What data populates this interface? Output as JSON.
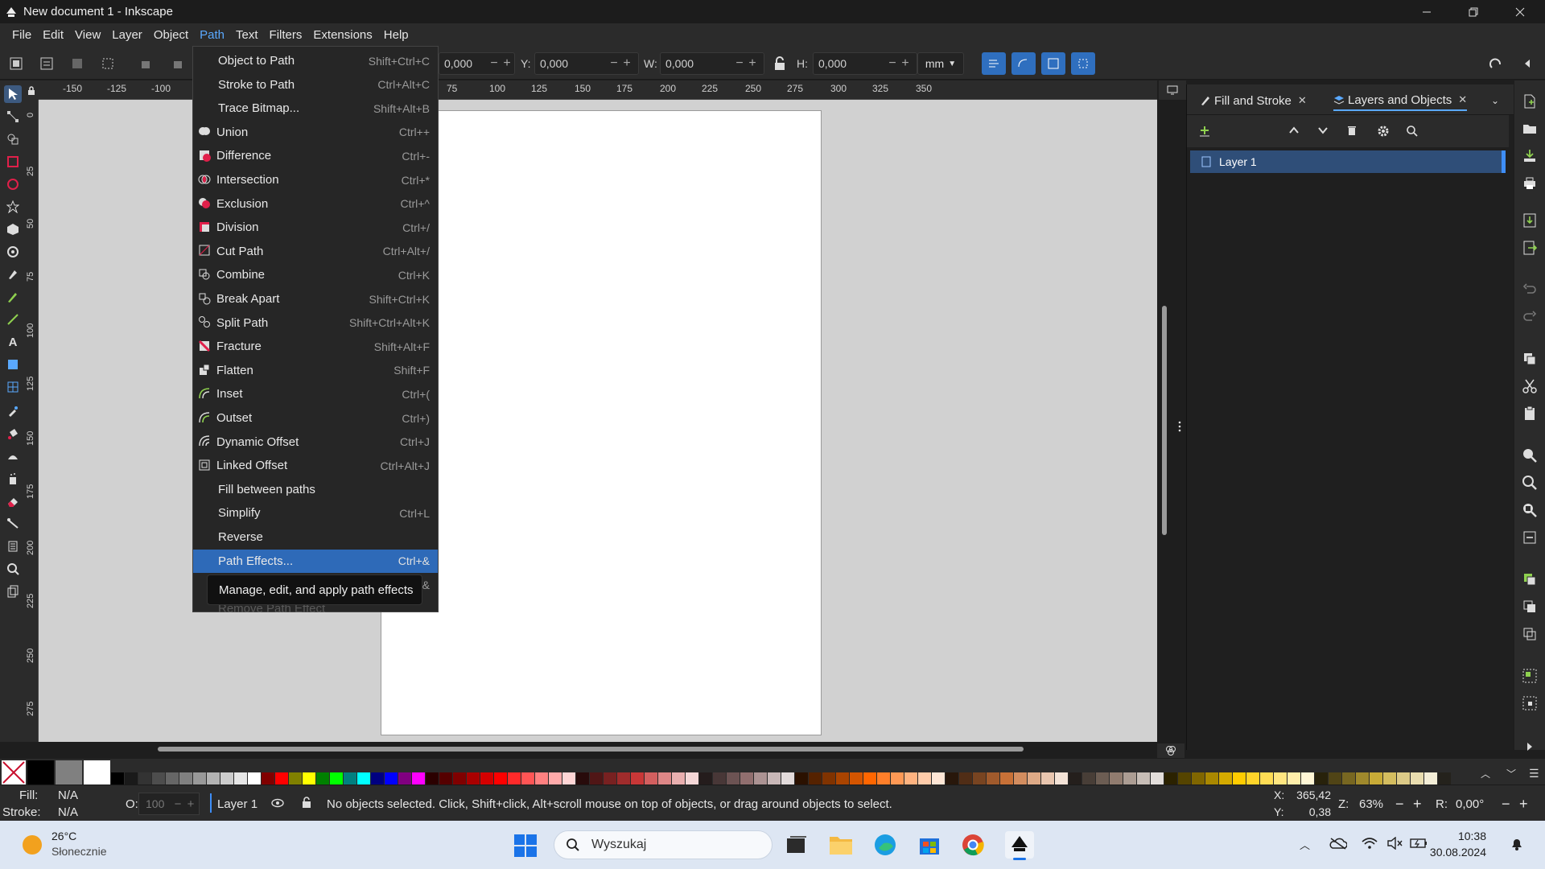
{
  "window": {
    "title": "New document 1 - Inkscape"
  },
  "menubar": [
    "File",
    "Edit",
    "View",
    "Layer",
    "Object",
    "Path",
    "Text",
    "Filters",
    "Extensions",
    "Help"
  ],
  "toolbar": {
    "x_value": "0,000",
    "y_label": "Y:",
    "y_value": "0,000",
    "w_label": "W:",
    "w_value": "0,000",
    "h_label": "H:",
    "h_value": "0,000",
    "unit": "mm"
  },
  "ruler_top": [
    "-150",
    "-125",
    "-100",
    "75",
    "100",
    "125",
    "150",
    "175",
    "200",
    "225",
    "250",
    "275",
    "300",
    "325",
    "350"
  ],
  "ruler_left": [
    "0",
    "25",
    "50",
    "75",
    "100",
    "125",
    "150",
    "175",
    "200",
    "225",
    "250",
    "275"
  ],
  "path_menu": {
    "items": [
      {
        "label": "Object to Path",
        "shortcut": "Shift+Ctrl+C",
        "icon": "none"
      },
      {
        "label": "Stroke to Path",
        "shortcut": "Ctrl+Alt+C",
        "icon": "none"
      },
      {
        "label": "Trace Bitmap...",
        "shortcut": "Shift+Alt+B",
        "icon": "none"
      },
      {
        "label": "Union",
        "shortcut": "Ctrl++",
        "icon": "union-icon"
      },
      {
        "label": "Difference",
        "shortcut": "Ctrl+-",
        "icon": "difference-icon"
      },
      {
        "label": "Intersection",
        "shortcut": "Ctrl+*",
        "icon": "intersection-icon"
      },
      {
        "label": "Exclusion",
        "shortcut": "Ctrl+^",
        "icon": "exclusion-icon"
      },
      {
        "label": "Division",
        "shortcut": "Ctrl+/",
        "icon": "division-icon"
      },
      {
        "label": "Cut Path",
        "shortcut": "Ctrl+Alt+/",
        "icon": "cut-path-icon"
      },
      {
        "label": "Combine",
        "shortcut": "Ctrl+K",
        "icon": "combine-icon"
      },
      {
        "label": "Break Apart",
        "shortcut": "Shift+Ctrl+K",
        "icon": "break-apart-icon"
      },
      {
        "label": "Split Path",
        "shortcut": "Shift+Ctrl+Alt+K",
        "icon": "split-path-icon"
      },
      {
        "label": "Fracture",
        "shortcut": "Shift+Alt+F",
        "icon": "fracture-icon"
      },
      {
        "label": "Flatten",
        "shortcut": "Shift+F",
        "icon": "flatten-icon"
      },
      {
        "label": "Inset",
        "shortcut": "Ctrl+(",
        "icon": "inset-icon"
      },
      {
        "label": "Outset",
        "shortcut": "Ctrl+)",
        "icon": "outset-icon"
      },
      {
        "label": "Dynamic Offset",
        "shortcut": "Ctrl+J",
        "icon": "dynamic-offset-icon"
      },
      {
        "label": "Linked Offset",
        "shortcut": "Ctrl+Alt+J",
        "icon": "linked-offset-icon"
      },
      {
        "label": "Fill between paths",
        "shortcut": "",
        "icon": "none"
      },
      {
        "label": "Simplify",
        "shortcut": "Ctrl+L",
        "icon": "none"
      },
      {
        "label": "Reverse",
        "shortcut": "",
        "icon": "none"
      },
      {
        "label": "Path Effects...",
        "shortcut": "Ctrl+&",
        "icon": "none",
        "highlighted": true
      },
      {
        "label": "Paste Path Effect",
        "shortcut": "&",
        "icon": "none",
        "dimmed": true
      },
      {
        "label": "Remove Path Effect",
        "shortcut": "",
        "icon": "none",
        "dimmed": true
      }
    ],
    "tooltip": "Manage, edit, and apply path effects"
  },
  "panel": {
    "tab1": "Fill and Stroke",
    "tab2": "Layers and Objects",
    "layer": "Layer 1"
  },
  "statusbar": {
    "fill_label": "Fill:",
    "fill_value": "N/A",
    "stroke_label": "Stroke:",
    "stroke_value": "N/A",
    "opacity_label": "O:",
    "opacity_value": "100",
    "layer": "Layer 1",
    "message": "No objects selected. Click, Shift+click, Alt+scroll mouse on top of objects, or drag around objects to select.",
    "x_label": "X:",
    "x_value": "365,42",
    "y_label": "Y:",
    "y_value": "0,38",
    "zoom_label": "Z:",
    "zoom_value": "63%",
    "rotation_label": "R:",
    "rotation_value": "0,00°"
  },
  "taskbar": {
    "temperature": "26°C",
    "weather": "Słonecznie",
    "search_placeholder": "Wyszukaj",
    "time": "10:38",
    "date": "30.08.2024"
  },
  "colors": {
    "accent": "#2e6ab8",
    "menu_highlight": "#2e6ab8",
    "palette": [
      "#000000",
      "#1a1a1a",
      "#333333",
      "#4d4d4d",
      "#666666",
      "#808080",
      "#999999",
      "#b3b3b3",
      "#cccccc",
      "#e6e6e6",
      "#ffffff",
      "#800000",
      "#ff0000",
      "#808000",
      "#ffff00",
      "#008000",
      "#00ff00",
      "#008080",
      "#00ffff",
      "#000080",
      "#0000ff",
      "#800080",
      "#ff00ff",
      "#2b0000",
      "#550000",
      "#800000",
      "#aa0000",
      "#d40000",
      "#ff0000",
      "#ff2a2a",
      "#ff5555",
      "#ff8080",
      "#ffaaaa",
      "#ffd5d5",
      "#280b0b",
      "#501616",
      "#782121",
      "#a02c2c",
      "#c83737",
      "#d35f5f",
      "#de8787",
      "#e9afaf",
      "#f4d7d7",
      "#241c1c",
      "#483737",
      "#6c5353",
      "#916f6f",
      "#ac9393",
      "#c8b7b7",
      "#e3dbdb",
      "#2b1100",
      "#552200",
      "#803300",
      "#aa4400",
      "#d45500",
      "#ff6600",
      "#ff7f2a",
      "#ff9955",
      "#ffb380",
      "#ffccaa",
      "#ffe6d5",
      "#28170b",
      "#502d16",
      "#784421",
      "#a05a2c",
      "#c87137",
      "#d38d5f",
      "#deaa87",
      "#e9c6af",
      "#f4e3d7",
      "#241f1c",
      "#483e37",
      "#6c5d53",
      "#917c6f",
      "#ac9d93",
      "#c8beb7",
      "#e3dedb",
      "#2b2200",
      "#554400",
      "#806600",
      "#aa8800",
      "#d4aa00",
      "#ffcc00",
      "#ffd42a",
      "#ffdd55",
      "#ffe680",
      "#ffeeaa",
      "#fff6d5",
      "#28220b",
      "#504416",
      "#786721",
      "#a0892c",
      "#c8ab37",
      "#d4bd5f",
      "#dcca87",
      "#e9ddaf",
      "#f4eed7",
      "#24221c"
    ]
  }
}
